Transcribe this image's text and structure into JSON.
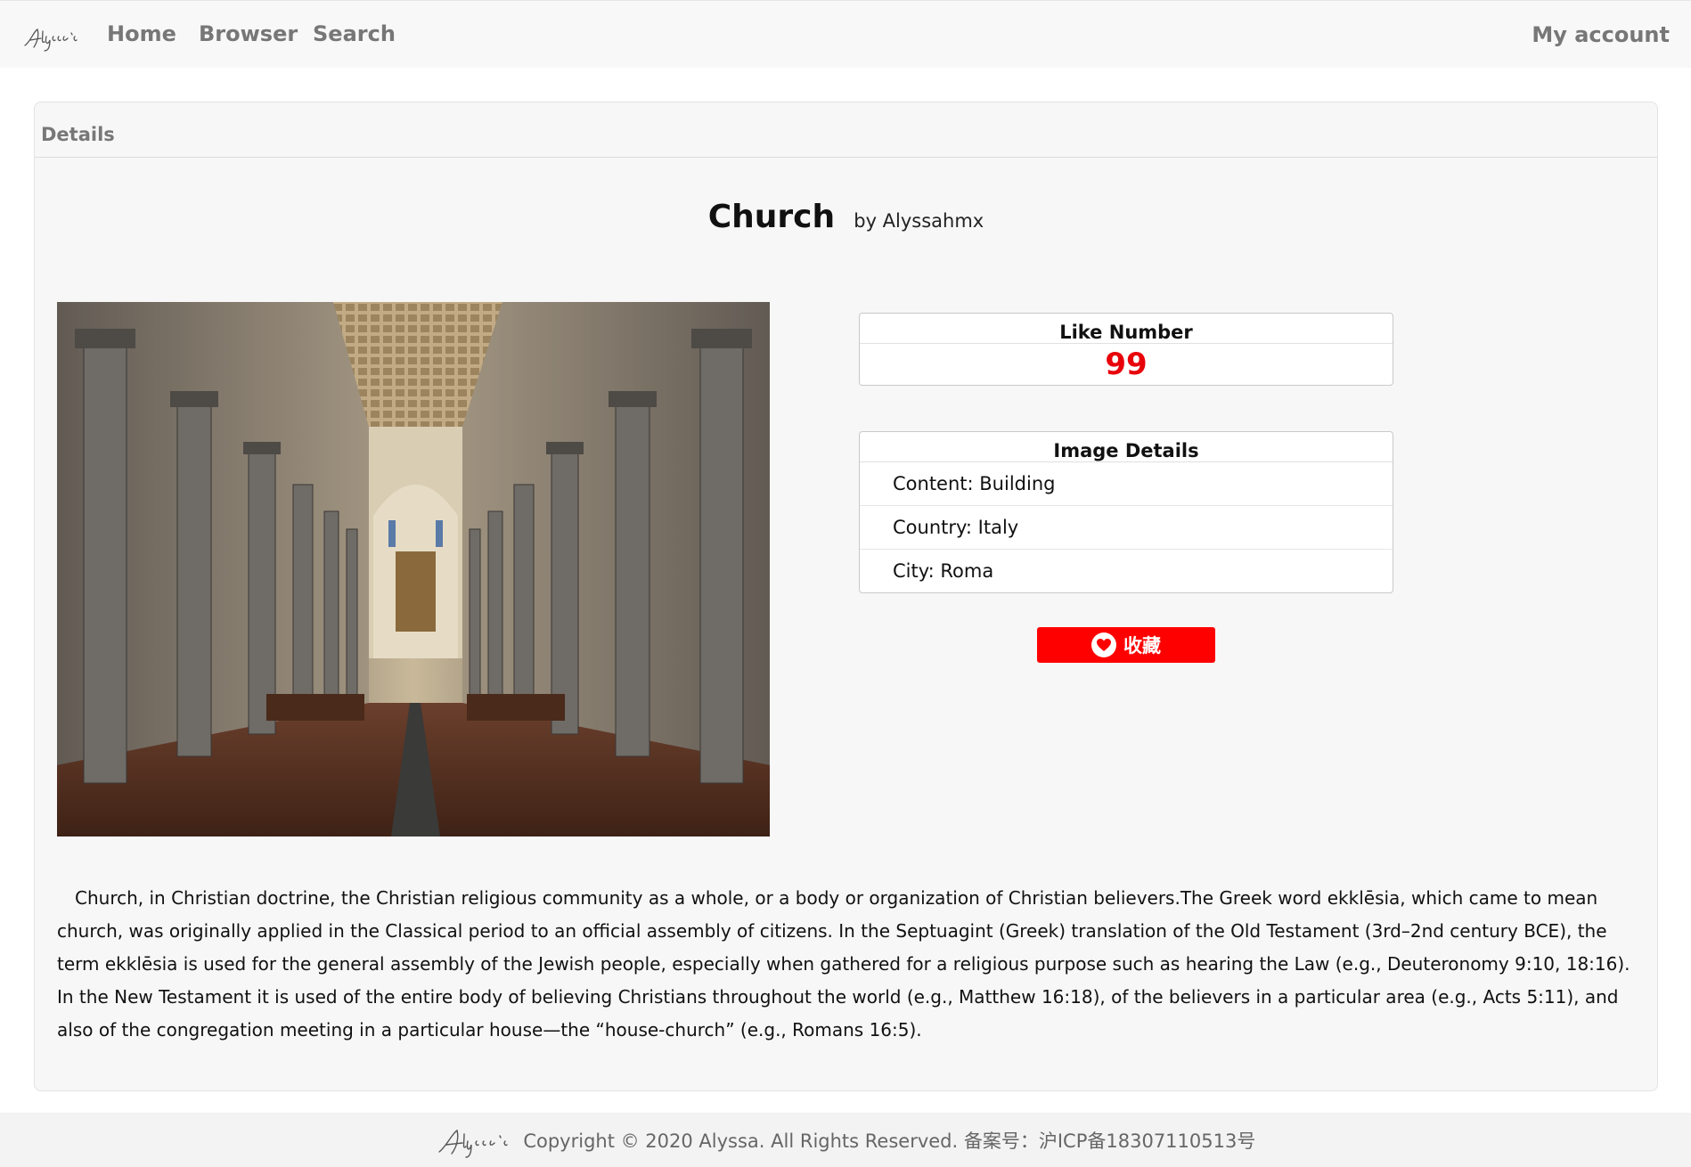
{
  "nav": {
    "brand": "Alyssa's",
    "links": [
      "Home",
      "Browser",
      "Search"
    ],
    "account": "My account"
  },
  "panel": {
    "heading": "Details"
  },
  "image": {
    "title": "Church",
    "author": "by Alyssahmx",
    "alt_subject": "church-interior-photo"
  },
  "like": {
    "heading": "Like Number",
    "value": "99"
  },
  "details": {
    "heading": "Image Details",
    "content": "Content: Building",
    "country": "Country: Italy",
    "city": "City: Roma"
  },
  "favorite_button": {
    "label": "收藏",
    "icon": "heart-icon"
  },
  "description": "Church, in Christian doctrine, the Christian religious community as a whole, or a body or organization of Christian believers.The Greek word ekklēsia, which came to mean church, was originally applied in the Classical period to an official assembly of citizens. In the Septuagint (Greek) translation of the Old Testament (3rd–2nd century BCE), the term ekklēsia is used for the general assembly of the Jewish people, especially when gathered for a religious purpose such as hearing the Law (e.g., Deuteronomy 9:10, 18:16). In the New Testament it is used of the entire body of believing Christians throughout the world (e.g., Matthew 16:18), of the believers in a particular area (e.g., Acts 5:11), and also of the congregation meeting in a particular house—the “house-church” (e.g., Romans 16:5).",
  "footer": {
    "brand": "Alyssa's",
    "text": "Copyright © 2020 Alyssa. All Rights Reserved. 备案号：沪ICP备18307110513号"
  },
  "colors": {
    "accent_red": "#ff0000",
    "like_red": "#e8000a",
    "nav_bg": "#f8f8f8",
    "panel_bg": "#f7f7f7"
  }
}
